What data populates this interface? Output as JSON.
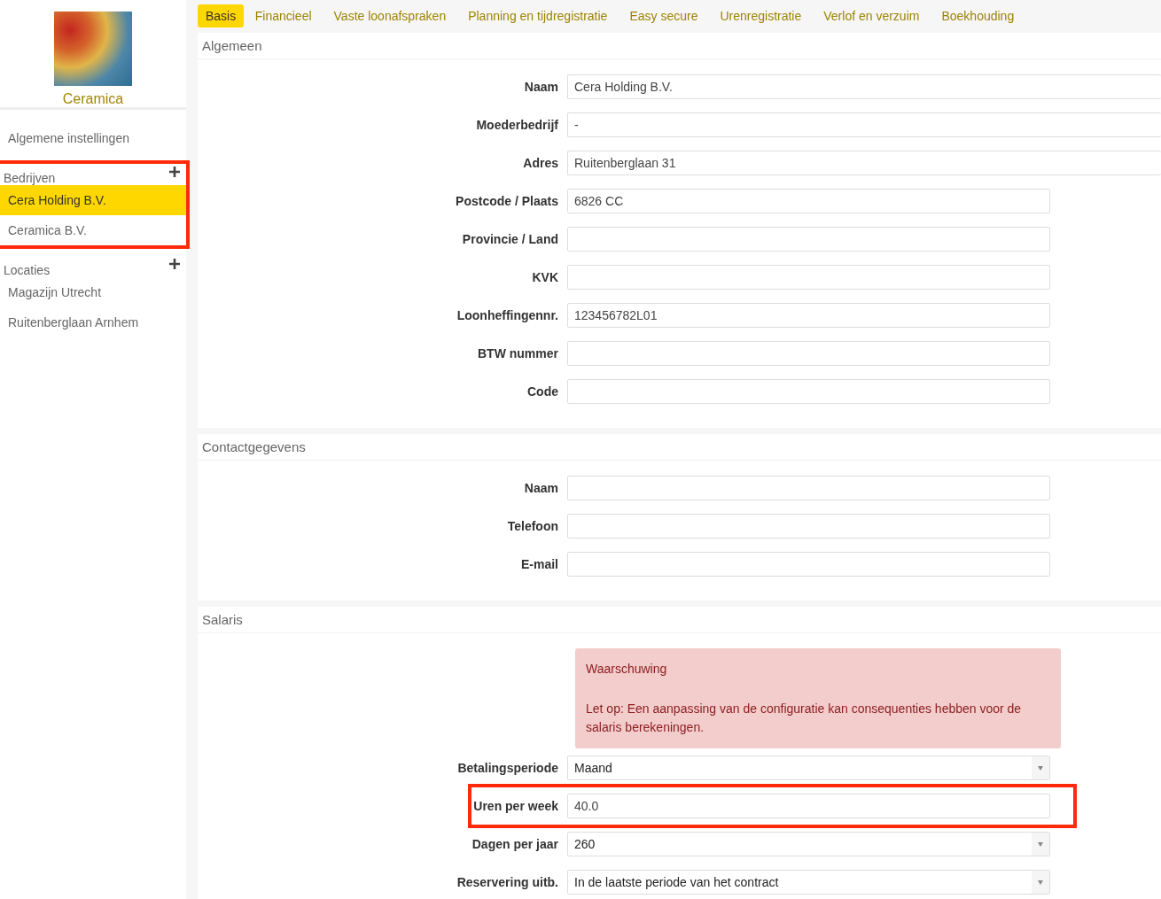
{
  "sidebar": {
    "brand": "Ceramica",
    "top_item": "Algemene instellingen",
    "groups": [
      {
        "title": "Bedrijven",
        "annotated": true,
        "items": [
          {
            "label": "Cera Holding B.V.",
            "selected": true
          },
          {
            "label": "Ceramica B.V.",
            "selected": false
          }
        ]
      },
      {
        "title": "Locaties",
        "annotated": false,
        "items": [
          {
            "label": "Magazijn Utrecht",
            "selected": false
          },
          {
            "label": "Ruitenberglaan Arnhem",
            "selected": false
          }
        ]
      }
    ]
  },
  "tabs": [
    {
      "label": "Basis",
      "selected": true
    },
    {
      "label": "Financieel",
      "selected": false
    },
    {
      "label": "Vaste loonafspraken",
      "selected": false
    },
    {
      "label": "Planning en tijdregistratie",
      "selected": false
    },
    {
      "label": "Easy secure",
      "selected": false
    },
    {
      "label": "Urenregistratie",
      "selected": false
    },
    {
      "label": "Verlof en verzuim",
      "selected": false
    },
    {
      "label": "Boekhouding",
      "selected": false
    }
  ],
  "panels": [
    {
      "title": "Algemeen",
      "fields": [
        {
          "label": "Naam",
          "kind": "text",
          "value": "Cera Holding B.V.",
          "wide": true
        },
        {
          "label": "Moederbedrijf",
          "kind": "text",
          "value": "-",
          "wide": true
        },
        {
          "label": "Adres",
          "kind": "text",
          "value": "Ruitenberglaan 31",
          "wide": true
        },
        {
          "label": "Postcode / Plaats",
          "kind": "text",
          "value": "6826 CC"
        },
        {
          "label": "Provincie / Land",
          "kind": "text"
        },
        {
          "label": "KVK",
          "kind": "text"
        },
        {
          "label": "Loonheffingennr.",
          "kind": "text",
          "value": "123456782L01"
        },
        {
          "label": "BTW nummer",
          "kind": "text"
        },
        {
          "label": "Code",
          "kind": "text"
        }
      ]
    },
    {
      "title": "Contactgegevens",
      "fields": [
        {
          "label": "Naam",
          "kind": "text"
        },
        {
          "label": "Telefoon",
          "kind": "text"
        },
        {
          "label": "E-mail",
          "kind": "text"
        }
      ]
    },
    {
      "title": "Salaris",
      "warning": {
        "title": "Waarschuwing",
        "message": "Let op: Een aanpassing van de configuratie kan consequenties hebben voor de salaris berekeningen."
      },
      "fields": [
        {
          "label": "Betalingsperiode",
          "kind": "select",
          "value": "Maand"
        },
        {
          "label": "Uren per week",
          "kind": "text",
          "value": "40.0",
          "annotated": true
        },
        {
          "label": "Dagen per jaar",
          "kind": "select",
          "value": "260"
        },
        {
          "label": "Reservering uitb.",
          "kind": "select",
          "value": "In de laatste periode van het contract"
        }
      ]
    }
  ]
}
